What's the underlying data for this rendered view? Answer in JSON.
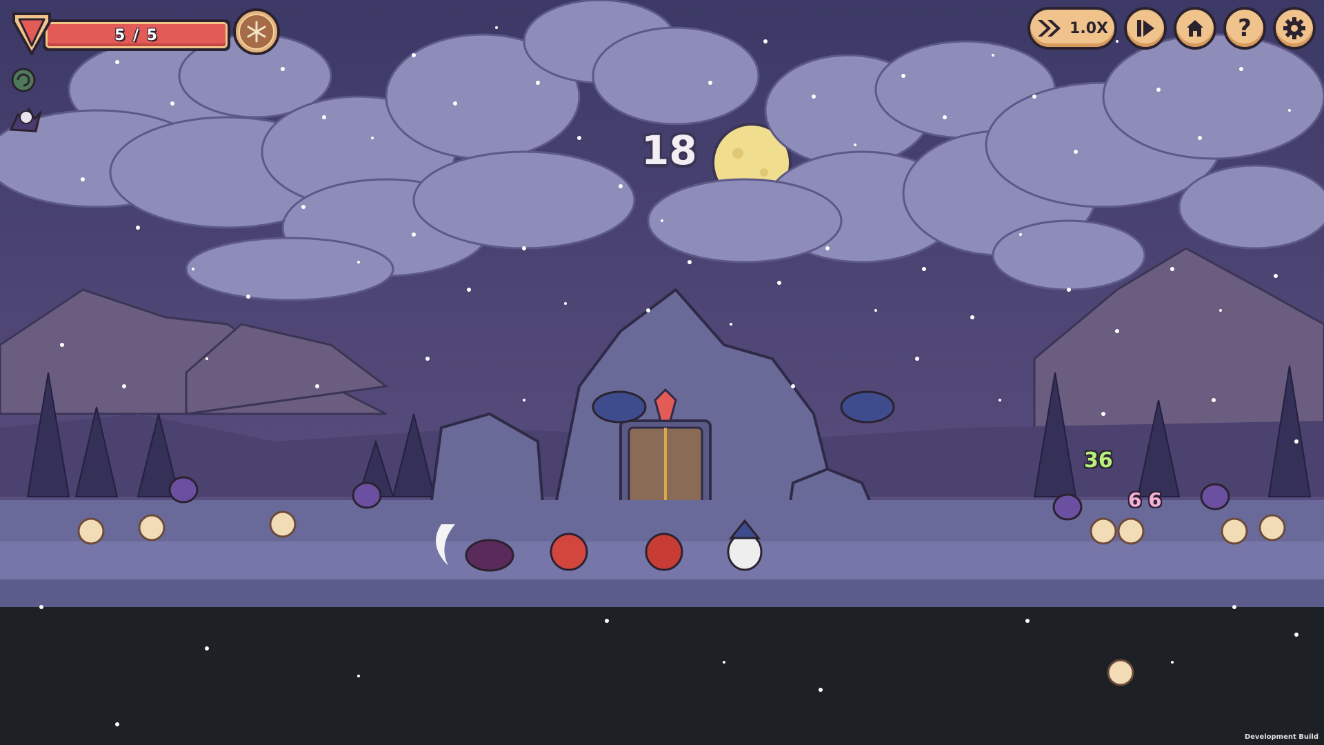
{
  "hud": {
    "health": {
      "current": 5,
      "max": 5,
      "text": "5 / 5",
      "fill_fraction": 1.0
    },
    "snowflake_ability": {
      "icon": "snowflake-icon"
    },
    "status_effects": [
      {
        "icon": "snail-shell-icon"
      },
      {
        "icon": "ghost-bat-icon"
      }
    ],
    "speed": {
      "label": "1.0X",
      "icon": "fast-forward-icon"
    },
    "buttons": [
      {
        "name": "play-step-button",
        "icon": "play-bar-icon"
      },
      {
        "name": "home-button",
        "icon": "home-icon"
      },
      {
        "name": "help-button",
        "glyph": "?"
      },
      {
        "name": "settings-button",
        "icon": "gear-icon"
      }
    ]
  },
  "wave_counter": "18",
  "damage_numbers": [
    {
      "text": "36",
      "color": "#b6f07a"
    },
    {
      "text": "6 6",
      "color": "#f5b0d8"
    }
  ],
  "footer": {
    "dev_build": "Development Build"
  },
  "colors": {
    "sky": "#4a4670",
    "clouds": "#8e8cb8",
    "moon": "#f0dd8e",
    "ground": "#6a6a9a",
    "path": "#6f6fa0",
    "underground": "#1d2024",
    "hp_fill": "#e25b57",
    "button_face": "#f0c38c"
  }
}
